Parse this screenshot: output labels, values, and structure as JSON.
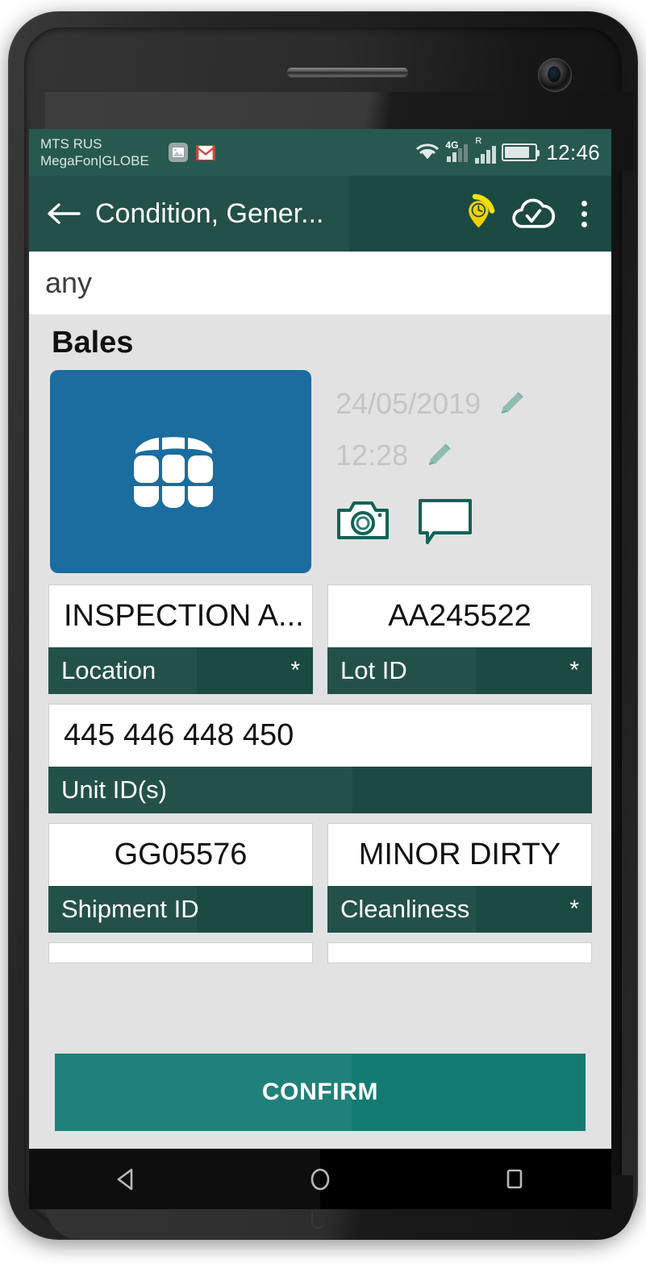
{
  "device": {
    "frame_color": "#1d1d1d",
    "screen_bg": "#e2e2e2"
  },
  "status_bar": {
    "carrier_line1": "MTS RUS",
    "carrier_line2": "MegaFon|GLOBE",
    "network_type": "4G",
    "roaming_label": "R",
    "clock": "12:46",
    "icons": [
      "screenshot-icon",
      "gmail-icon",
      "wifi-icon",
      "signal-icon",
      "roaming-signal-icon",
      "battery-icon"
    ],
    "bg_color": "#275950"
  },
  "app_bar": {
    "title": "Condition, Gener...",
    "back_icon": "arrow-left-icon",
    "gps_icon": "location-pin-clock-icon",
    "cloud_icon": "cloud-check-icon",
    "overflow_icon": "more-vertical-icon",
    "bg_color": "#1b4a43",
    "accent_color": "#f5d800"
  },
  "search": {
    "value": "any",
    "placeholder": "any"
  },
  "main": {
    "section_title": "Bales",
    "bale_icon": "bale-icon",
    "bale_card_color": "#1a6d9e",
    "date": {
      "value": "24/05/2019",
      "edit_icon": "pencil-icon"
    },
    "time": {
      "value": "12:28",
      "edit_icon": "pencil-icon"
    },
    "camera_icon": "camera-icon",
    "comment_icon": "comment-bubble-icon"
  },
  "fields": [
    [
      {
        "value": "INSPECTION A...",
        "label": "Location",
        "required": "*",
        "align": "left"
      },
      {
        "value": "AA245522",
        "label": "Lot ID",
        "required": "*",
        "align": "center"
      }
    ],
    [
      {
        "value": "445 446 448 450",
        "label": "Unit ID(s)",
        "required": "",
        "align": "left",
        "full": true
      }
    ],
    [
      {
        "value": "GG05576",
        "label": "Shipment ID",
        "required": "",
        "align": "center"
      },
      {
        "value": "MINOR DIRTY",
        "label": "Cleanliness",
        "required": "*",
        "align": "center"
      }
    ]
  ],
  "confirm": {
    "label": "CONFIRM",
    "color": "#137a72"
  },
  "nav_bar": {
    "back_icon": "triangle-back-icon",
    "home_icon": "circle-home-icon",
    "recents_icon": "square-recents-icon",
    "bg_color": "#000000"
  }
}
